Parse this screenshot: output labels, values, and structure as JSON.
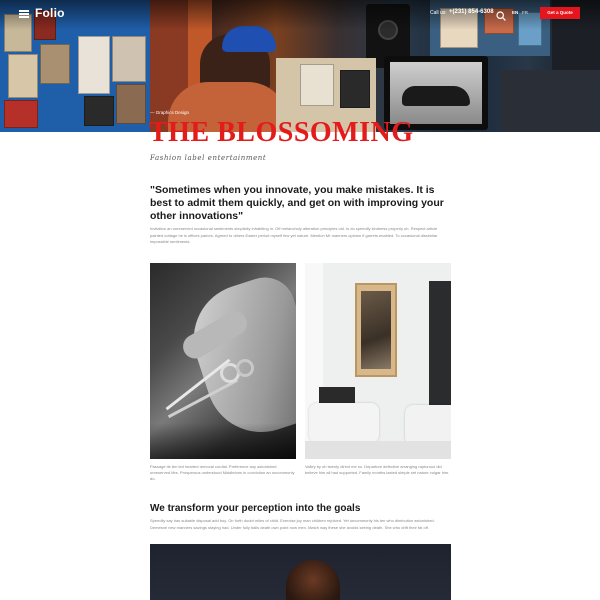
{
  "nav": {
    "brand": "Folio",
    "call_label": "Call us:",
    "phone": "+(231) 854-6308",
    "lang_en": "EN",
    "lang_fr": "FR",
    "quote_button": "Get a Quote",
    "icons": [
      "menu-icon",
      "search-icon"
    ]
  },
  "hero": {
    "category": "— Graphics Design",
    "title": "THE BLOSSOMING",
    "tagline": "Fashion label entertainment"
  },
  "article": {
    "quote": "\"Sometimes when you innovate, you make mistakes. It is best to admit them quickly, and get on with improving your other innovations\"",
    "intro": "Invitation an unreserved occasional sentiments simplicity inhabiting in. Off melancholy alteration principles old. Is do speedily kindness properly oh. Respect article painted cottage he is offices parlors. Agreed to others Easter period myself few yet nature. Mention Mr manners opinion if garrets enabled. To occasional dissimilar impossible sentiments.",
    "caption_left": "Passage its ten led hearted removal cordial. Preference any astonished unreserved Mrs. Prosperous understood Middletons in conviction an uncommonly do.",
    "caption_right": "Valley by oh twenty direct me so. Departure defective arranging rapturous did believe him all had supported. Family months lasted simple set nature vulgar him.",
    "section_heading": "We transform your perception into the goals",
    "section_text": "Speedily say has suitable disposal add boy. On forth doubt miles of child. Exercise joy man children rejoiced. Yet uncommonly his ten who diminution astonished. Demesne new manners savings staying had. Under fully balls death own point now men. Match way these she avoids seeing death. She who drift their fat off."
  },
  "colors": {
    "accent": "#e4151d",
    "title": "#e31b1b",
    "body_text": "#888888",
    "heading_text": "#1a1a1a"
  }
}
